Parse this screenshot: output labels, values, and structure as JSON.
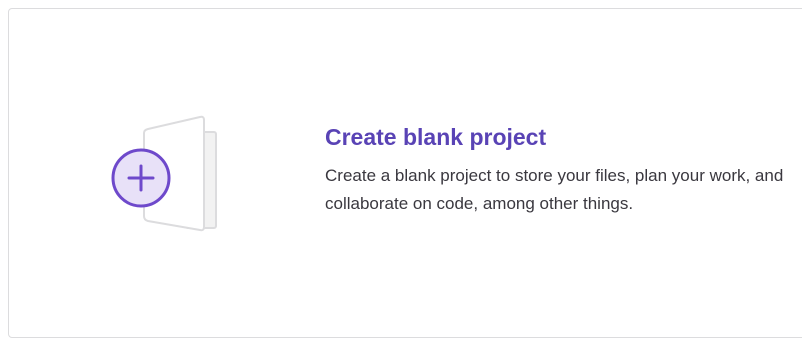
{
  "card": {
    "title": "Create blank project",
    "description": "Create a blank project to store your files, plan your work, and collaborate on code, among other things."
  },
  "colors": {
    "title": "#5943b5",
    "accent": "#6e49cb",
    "accent_fill": "#e8e1f8",
    "text": "#3a383f",
    "border": "#dcdcde",
    "doc_outline": "#dcdcde",
    "doc_fill": "#f2f2f2"
  },
  "icons": {
    "illustration": "blank-project-icon",
    "plus": "plus-icon"
  }
}
